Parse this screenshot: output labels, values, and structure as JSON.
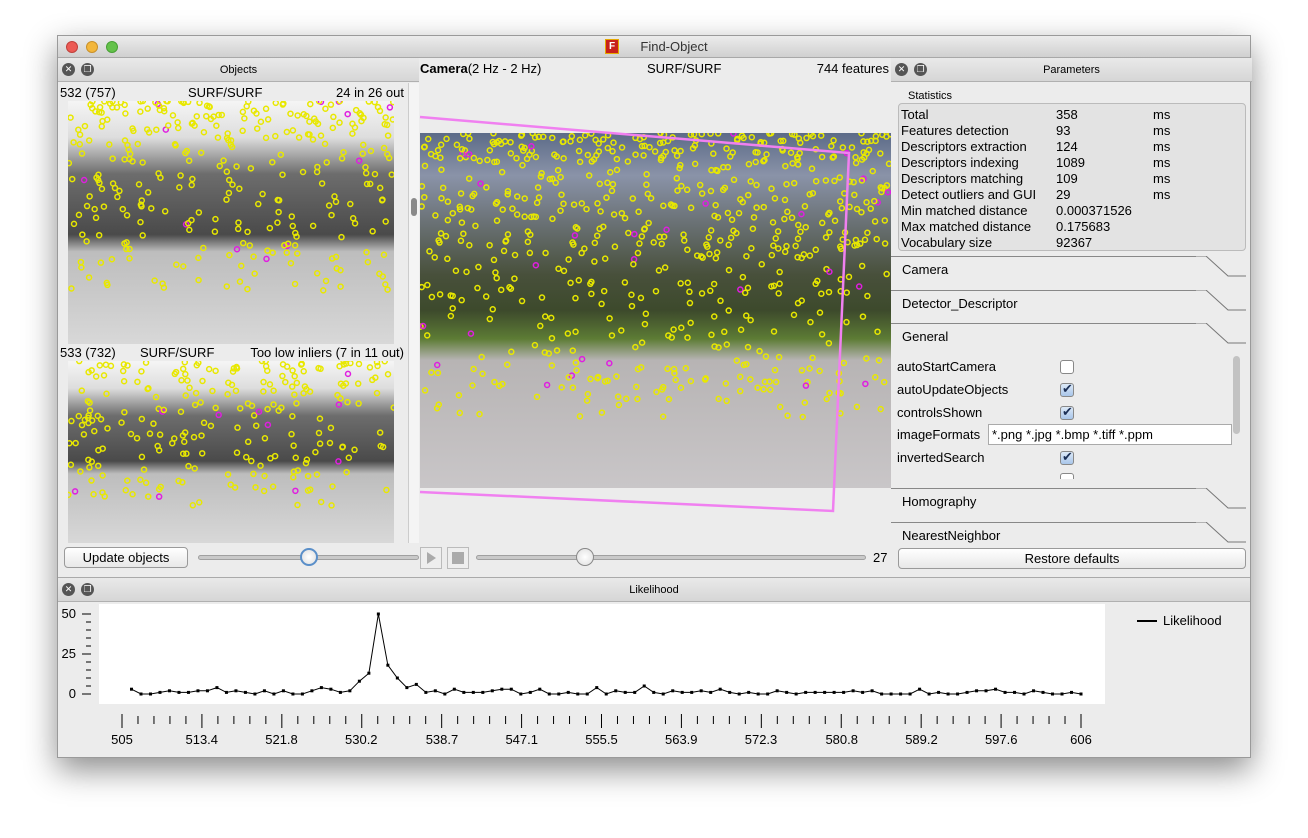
{
  "window": {
    "title": "Find-Object",
    "app_icon": "F"
  },
  "objects_dock": {
    "title": "Objects",
    "items": [
      {
        "id_label": "532 (757)",
        "method": "SURF/SURF",
        "status": "24 in 26 out"
      },
      {
        "id_label": "533 (732)",
        "method": "SURF/SURF",
        "status": "Too low inliers (7 in 11 out)"
      }
    ],
    "update_button": "Update objects",
    "slider_value": 0.5
  },
  "camera_view": {
    "title_bold": "Camera",
    "rate": "(2 Hz - 2 Hz)",
    "method": "SURF/SURF",
    "features": "744 features",
    "frame_slider_value": 0.28,
    "frame_number": "27"
  },
  "parameters_dock": {
    "title": "Parameters",
    "statistics_label": "Statistics",
    "statistics": [
      {
        "name": "Total",
        "value": "358",
        "unit": "ms"
      },
      {
        "name": "Features detection",
        "value": "93",
        "unit": "ms"
      },
      {
        "name": "Descriptors extraction",
        "value": "124",
        "unit": "ms"
      },
      {
        "name": "Descriptors indexing",
        "value": "1089",
        "unit": "ms"
      },
      {
        "name": "Descriptors matching",
        "value": "109",
        "unit": "ms"
      },
      {
        "name": "Detect outliers and GUI",
        "value": "29",
        "unit": "ms"
      },
      {
        "name": "Min matched distance",
        "value": "0.000371526",
        "unit": ""
      },
      {
        "name": "Max matched distance",
        "value": "0.175683",
        "unit": ""
      },
      {
        "name": "Vocabulary size",
        "value": "92367",
        "unit": ""
      }
    ],
    "sections": [
      "Camera",
      "Detector_Descriptor",
      "General",
      "Homography",
      "NearestNeighbor"
    ],
    "general": {
      "autoStartCamera": {
        "label": "autoStartCamera",
        "checked": false
      },
      "autoUpdateObjects": {
        "label": "autoUpdateObjects",
        "checked": true
      },
      "controlsShown": {
        "label": "controlsShown",
        "checked": true
      },
      "imageFormats": {
        "label": "imageFormats",
        "value": "*.png *.jpg *.bmp *.tiff *.ppm"
      },
      "invertedSearch": {
        "label": "invertedSearch",
        "checked": true
      }
    },
    "restore_button": "Restore defaults"
  },
  "likelihood_dock": {
    "title": "Likelihood"
  },
  "colors": {
    "inlier": "#e01ee0",
    "feature": "#e8e800",
    "homography": "#f080f0"
  },
  "chart_data": {
    "type": "line",
    "title": "",
    "legend": {
      "entries": [
        "Likelihood"
      ],
      "placement": "top-right"
    },
    "xlim": [
      505,
      606
    ],
    "ylim": [
      0,
      50
    ],
    "xticks": [
      "505",
      "513.4",
      "521.8",
      "530.2",
      "538.7",
      "547.1",
      "555.5",
      "563.9",
      "572.3",
      "580.8",
      "589.2",
      "597.6",
      "606"
    ],
    "yticks": [
      "0",
      "25",
      "50"
    ],
    "series": [
      {
        "name": "Likelihood",
        "x_start": 506,
        "x_step": 1,
        "values": [
          3,
          0,
          0,
          1,
          2,
          1,
          1,
          2,
          2,
          4,
          1,
          2,
          1,
          0,
          2,
          0,
          2,
          0,
          0,
          2,
          4,
          3,
          1,
          2,
          8,
          13,
          50,
          18,
          10,
          4,
          6,
          1,
          2,
          0,
          3,
          1,
          1,
          1,
          2,
          3,
          3,
          0,
          1,
          3,
          0,
          0,
          1,
          0,
          0,
          4,
          0,
          2,
          1,
          1,
          5,
          1,
          0,
          2,
          1,
          1,
          2,
          1,
          3,
          1,
          0,
          1,
          0,
          0,
          2,
          1,
          0,
          1,
          1,
          1,
          1,
          1,
          2,
          1,
          2,
          0,
          0,
          0,
          0,
          3,
          0,
          1,
          0,
          0,
          1,
          2,
          2,
          3,
          1,
          1,
          0,
          2,
          1,
          0,
          0,
          1,
          0
        ]
      }
    ]
  }
}
